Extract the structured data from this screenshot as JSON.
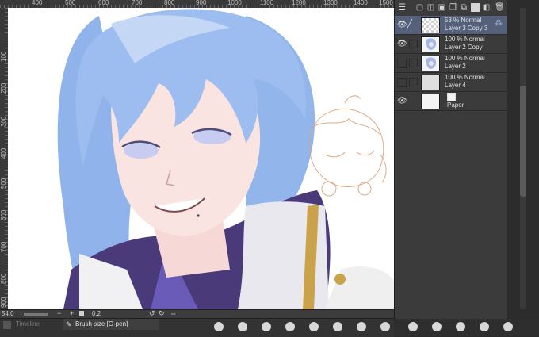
{
  "ruler": {
    "top_ticks": [
      "400",
      "500",
      "600",
      "700",
      "800",
      "900",
      "1000",
      "1100",
      "1200",
      "1300",
      "1400",
      "1500",
      "1600"
    ],
    "left_ticks": [
      "100",
      "200",
      "300",
      "400",
      "500",
      "600",
      "700",
      "800",
      "900"
    ]
  },
  "status": {
    "zoom": "54.0",
    "rotation": "0.2"
  },
  "bottom": {
    "tab_label": "Timeline",
    "brush_label": "Brush size [G-pen]"
  },
  "layers": [
    {
      "mode": "53 % Normal",
      "name": "Layer 3 Copy 3",
      "visible": true,
      "selected": true,
      "thumb": "check"
    },
    {
      "mode": "100 % Normal",
      "name": "Layer 2 Copy",
      "visible": true,
      "selected": false,
      "thumb": "figure"
    },
    {
      "mode": "100 % Normal",
      "name": "Layer 2",
      "visible": false,
      "selected": false,
      "thumb": "figure"
    },
    {
      "mode": "100 % Normal",
      "name": "Layer 4",
      "visible": false,
      "selected": false,
      "thumb": "light"
    },
    {
      "mode": "",
      "name": "Paper",
      "visible": true,
      "selected": false,
      "thumb": "white"
    }
  ],
  "colors": {
    "accent_selection": "#55607a",
    "panel_bg": "#3b3b3b",
    "hair_blue": "#8fb3ea"
  }
}
